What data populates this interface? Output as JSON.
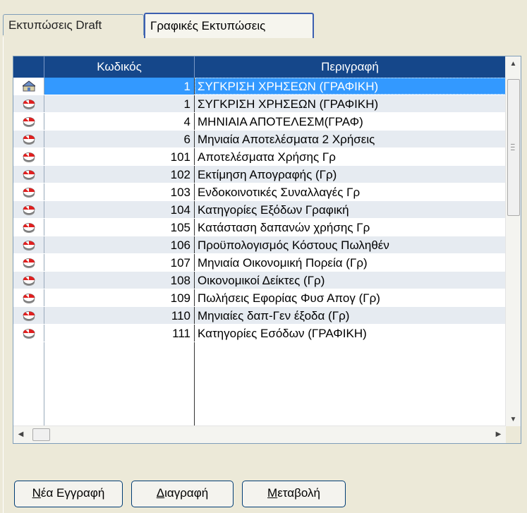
{
  "tabs": [
    {
      "label": "Εκτυπώσεις Draft"
    },
    {
      "label": "Γραφικές Εκτυπώσεις"
    }
  ],
  "grid": {
    "columns": [
      "Κωδικός",
      "Περιγραφή"
    ],
    "rows": [
      {
        "icon": "home-icon",
        "code": "1",
        "description": "ΣΥΓΚΡΙΣΗ ΧΡΗΣΕΩΝ (ΓΡΑΦΙΚΗ)"
      },
      {
        "icon": "chart-icon",
        "code": "1",
        "description": "ΣΥΓΚΡΙΣΗ ΧΡΗΣΕΩΝ (ΓΡΑΦΙΚΗ)"
      },
      {
        "icon": "chart-icon",
        "code": "4",
        "description": "ΜΗΝΙΑΙΑ ΑΠΟΤΕΛΕΣΜ(ΓΡΑΦ)"
      },
      {
        "icon": "chart-icon",
        "code": "6",
        "description": "Μηνιαία Αποτελέσματα 2 Χρήσεις"
      },
      {
        "icon": "chart-icon",
        "code": "101",
        "description": "Αποτελέσματα Χρήσης Γρ"
      },
      {
        "icon": "chart-icon",
        "code": "102",
        "description": "Εκτίμηση Απογραφής (Γρ)"
      },
      {
        "icon": "chart-icon",
        "code": "103",
        "description": "Ενδοκοινοτικές  Συναλλαγές Γρ"
      },
      {
        "icon": "chart-icon",
        "code": "104",
        "description": "Κατηγορίες Εξόδων Γραφική"
      },
      {
        "icon": "chart-icon",
        "code": "105",
        "description": "Κατάσταση δαπανών χρήσης Γρ"
      },
      {
        "icon": "chart-icon",
        "code": "106",
        "description": "Προϋπολογισμός Κόστους Πωληθέν"
      },
      {
        "icon": "chart-icon",
        "code": "107",
        "description": "Μηνιαία Οικονομική Πορεία (Γρ)"
      },
      {
        "icon": "chart-icon",
        "code": "108",
        "description": "Οικονομικοί Δείκτες (Γρ)"
      },
      {
        "icon": "chart-icon",
        "code": "109",
        "description": "Πωλήσεις Εφορίας Φυσ Απογ (Γρ)"
      },
      {
        "icon": "chart-icon",
        "code": "110",
        "description": "Μηνιαίες δαπ-Γεν έξοδα (Γρ)"
      },
      {
        "icon": "chart-icon",
        "code": "111",
        "description": "Κατηγορίες Εσόδων (ΓΡΑΦΙΚΗ)"
      }
    ]
  },
  "buttons": {
    "new": {
      "first": "Ν",
      "rest": "έα Εγγραφή"
    },
    "delete": {
      "first": "Δ",
      "rest": "ιαγραφή"
    },
    "edit": {
      "first": "Μ",
      "rest": "εταβολή"
    }
  },
  "colors": {
    "header_bg": "#15478a",
    "selection": "#3399ff",
    "alt_row": "#e6ebf1"
  }
}
